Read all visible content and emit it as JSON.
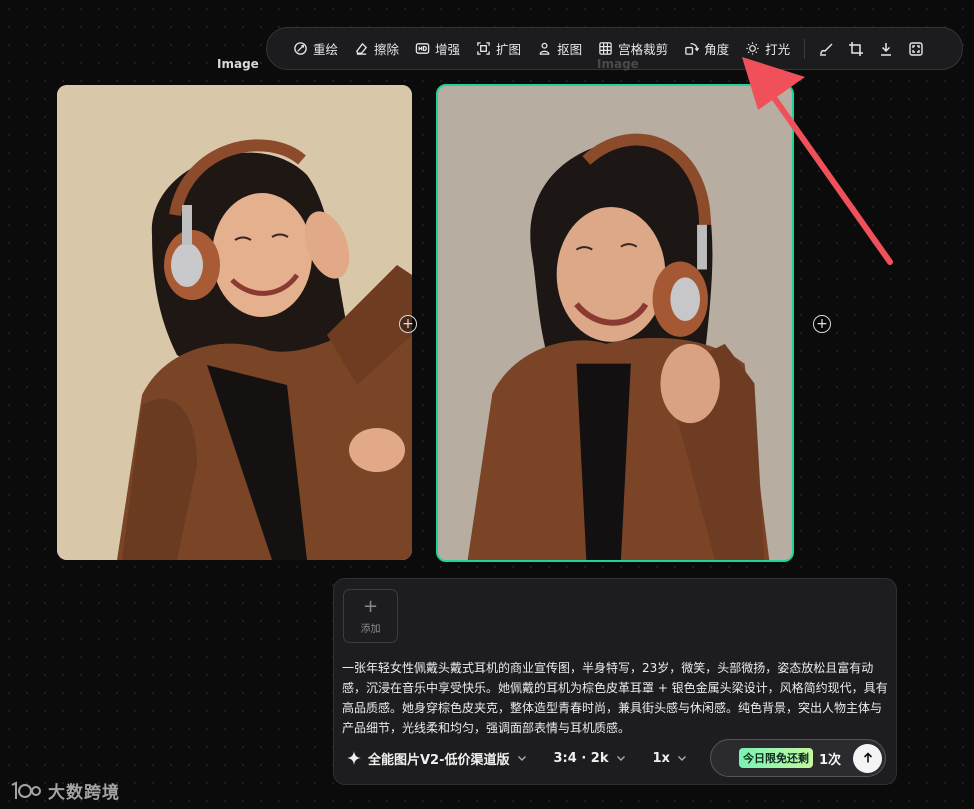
{
  "toolbar": {
    "items": [
      {
        "label": "重绘",
        "icon": "repaint-icon"
      },
      {
        "label": "擦除",
        "icon": "eraser-icon"
      },
      {
        "label": "增强",
        "icon": "hd-icon"
      },
      {
        "label": "扩图",
        "icon": "expand-icon"
      },
      {
        "label": "抠图",
        "icon": "person-cutout-icon"
      },
      {
        "label": "宫格裁剪",
        "icon": "grid-icon"
      },
      {
        "label": "角度",
        "icon": "rotate-angle-icon"
      },
      {
        "label": "打光",
        "icon": "light-bulb-icon"
      }
    ],
    "right_icons": [
      "brush-icon",
      "crop-icon",
      "download-icon",
      "fullscreen-icon"
    ]
  },
  "nodes": {
    "left_label": "Image",
    "right_label": "Image"
  },
  "prompt_panel": {
    "add_label": "添加",
    "prompt": "一张年轻女性佩戴头戴式耳机的商业宣传图，半身特写，23岁，微笑，头部微扬，姿态放松且富有动感，沉浸在音乐中享受快乐。她佩戴的耳机为棕色皮革耳罩 + 银色金属头梁设计，风格简约现代，具有高品质感。她身穿棕色皮夹克，整体造型青春时尚，兼具街头感与休闲感。纯色背景，突出人物主体与产品细节，光线柔和均匀，强调面部表情与耳机质感。",
    "model": "全能图片V2-低价渠道版",
    "ratio": "3:4 · 2k",
    "count": "1x",
    "free_badge": "今日限免还剩",
    "remaining": "1次"
  },
  "watermark": "大数跨境",
  "colors": {
    "accent": "#1fd49b",
    "arrow": "#f0505a",
    "background": "#0b0b0c"
  }
}
